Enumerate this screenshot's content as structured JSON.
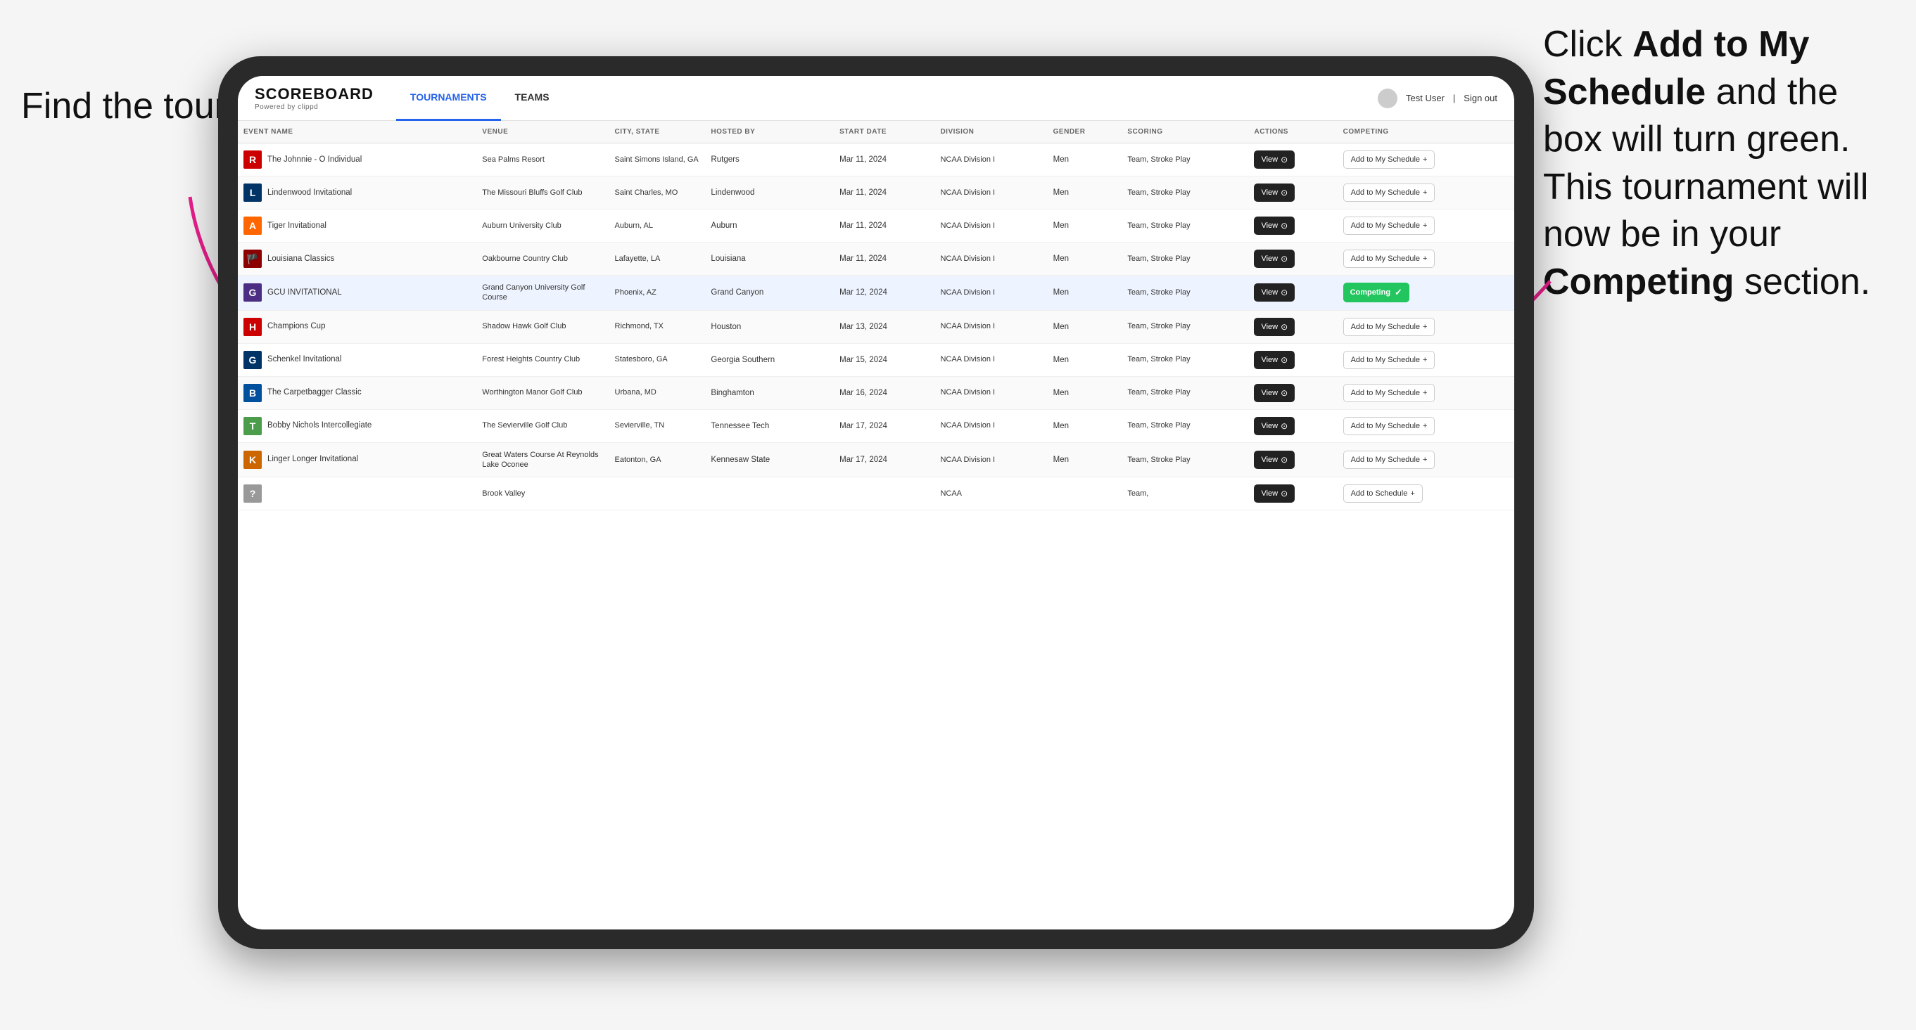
{
  "annotations": {
    "left": "Find the\ntournament.",
    "right_line1": "Click ",
    "right_bold1": "Add to My\nSchedule",
    "right_line2": " and the\nbox will turn green.\nThis tournament\nwill now be in\nyour ",
    "right_bold2": "Competing",
    "right_line3": "\nsection."
  },
  "navbar": {
    "logo": "SCOREBOARD",
    "logo_sub": "Powered by clippd",
    "nav_items": [
      "TOURNAMENTS",
      "TEAMS"
    ],
    "active_nav": "TOURNAMENTS",
    "user": "Test User",
    "sign_out": "Sign out"
  },
  "table": {
    "columns": [
      "EVENT NAME",
      "VENUE",
      "CITY, STATE",
      "HOSTED BY",
      "START DATE",
      "DIVISION",
      "GENDER",
      "SCORING",
      "ACTIONS",
      "COMPETING"
    ],
    "rows": [
      {
        "logo": "R",
        "logo_color": "#cc0000",
        "name": "The Johnnie - O Individual",
        "venue": "Sea Palms Resort",
        "city": "Saint Simons Island, GA",
        "hosted_by": "Rutgers",
        "start_date": "Mar 11, 2024",
        "division": "NCAA Division I",
        "gender": "Men",
        "scoring": "Team, Stroke Play",
        "action": "View",
        "competing": "Add to My Schedule",
        "is_competing": false,
        "highlighted": false
      },
      {
        "logo": "L",
        "logo_color": "#003366",
        "name": "Lindenwood Invitational",
        "venue": "The Missouri Bluffs Golf Club",
        "city": "Saint Charles, MO",
        "hosted_by": "Lindenwood",
        "start_date": "Mar 11, 2024",
        "division": "NCAA Division I",
        "gender": "Men",
        "scoring": "Team, Stroke Play",
        "action": "View",
        "competing": "Add to My Schedule",
        "is_competing": false,
        "highlighted": false
      },
      {
        "logo": "A",
        "logo_color": "#ff6600",
        "name": "Tiger Invitational",
        "venue": "Auburn University Club",
        "city": "Auburn, AL",
        "hosted_by": "Auburn",
        "start_date": "Mar 11, 2024",
        "division": "NCAA Division I",
        "gender": "Men",
        "scoring": "Team, Stroke Play",
        "action": "View",
        "competing": "Add to My Schedule",
        "is_competing": false,
        "highlighted": false
      },
      {
        "logo": "🏴",
        "logo_color": "#8b0000",
        "name": "Louisiana Classics",
        "venue": "Oakbourne Country Club",
        "city": "Lafayette, LA",
        "hosted_by": "Louisiana",
        "start_date": "Mar 11, 2024",
        "division": "NCAA Division I",
        "gender": "Men",
        "scoring": "Team, Stroke Play",
        "action": "View",
        "competing": "Add to My Schedule",
        "is_competing": false,
        "highlighted": false
      },
      {
        "logo": "G",
        "logo_color": "#4b2d83",
        "name": "GCU INVITATIONAL",
        "venue": "Grand Canyon University Golf Course",
        "city": "Phoenix, AZ",
        "hosted_by": "Grand Canyon",
        "start_date": "Mar 12, 2024",
        "division": "NCAA Division I",
        "gender": "Men",
        "scoring": "Team, Stroke Play",
        "action": "View",
        "competing": "Competing",
        "is_competing": true,
        "highlighted": true
      },
      {
        "logo": "H",
        "logo_color": "#cc0000",
        "name": "Champions Cup",
        "venue": "Shadow Hawk Golf Club",
        "city": "Richmond, TX",
        "hosted_by": "Houston",
        "start_date": "Mar 13, 2024",
        "division": "NCAA Division I",
        "gender": "Men",
        "scoring": "Team, Stroke Play",
        "action": "View",
        "competing": "Add to My Schedule",
        "is_competing": false,
        "highlighted": false
      },
      {
        "logo": "G",
        "logo_color": "#003366",
        "name": "Schenkel Invitational",
        "venue": "Forest Heights Country Club",
        "city": "Statesboro, GA",
        "hosted_by": "Georgia Southern",
        "start_date": "Mar 15, 2024",
        "division": "NCAA Division I",
        "gender": "Men",
        "scoring": "Team, Stroke Play",
        "action": "View",
        "competing": "Add to My Schedule",
        "is_competing": false,
        "highlighted": false
      },
      {
        "logo": "B",
        "logo_color": "#00509e",
        "name": "The Carpetbagger Classic",
        "venue": "Worthington Manor Golf Club",
        "city": "Urbana, MD",
        "hosted_by": "Binghamton",
        "start_date": "Mar 16, 2024",
        "division": "NCAA Division I",
        "gender": "Men",
        "scoring": "Team, Stroke Play",
        "action": "View",
        "competing": "Add to My Schedule",
        "is_competing": false,
        "highlighted": false
      },
      {
        "logo": "T",
        "logo_color": "#4b9c4b",
        "name": "Bobby Nichols Intercollegiate",
        "venue": "The Sevierville Golf Club",
        "city": "Sevierville, TN",
        "hosted_by": "Tennessee Tech",
        "start_date": "Mar 17, 2024",
        "division": "NCAA Division I",
        "gender": "Men",
        "scoring": "Team, Stroke Play",
        "action": "View",
        "competing": "Add to My Schedule",
        "is_competing": false,
        "highlighted": false
      },
      {
        "logo": "K",
        "logo_color": "#cc6600",
        "name": "Linger Longer Invitational",
        "venue": "Great Waters Course At Reynolds Lake Oconee",
        "city": "Eatonton, GA",
        "hosted_by": "Kennesaw State",
        "start_date": "Mar 17, 2024",
        "division": "NCAA Division I",
        "gender": "Men",
        "scoring": "Team, Stroke Play",
        "action": "View",
        "competing": "Add to My Schedule",
        "is_competing": false,
        "highlighted": false
      },
      {
        "logo": "?",
        "logo_color": "#999",
        "name": "",
        "venue": "Brook Valley",
        "city": "",
        "hosted_by": "",
        "start_date": "",
        "division": "NCAA",
        "gender": "",
        "scoring": "Team,",
        "action": "View",
        "competing": "Add to Schedule",
        "is_competing": false,
        "highlighted": false
      }
    ]
  }
}
